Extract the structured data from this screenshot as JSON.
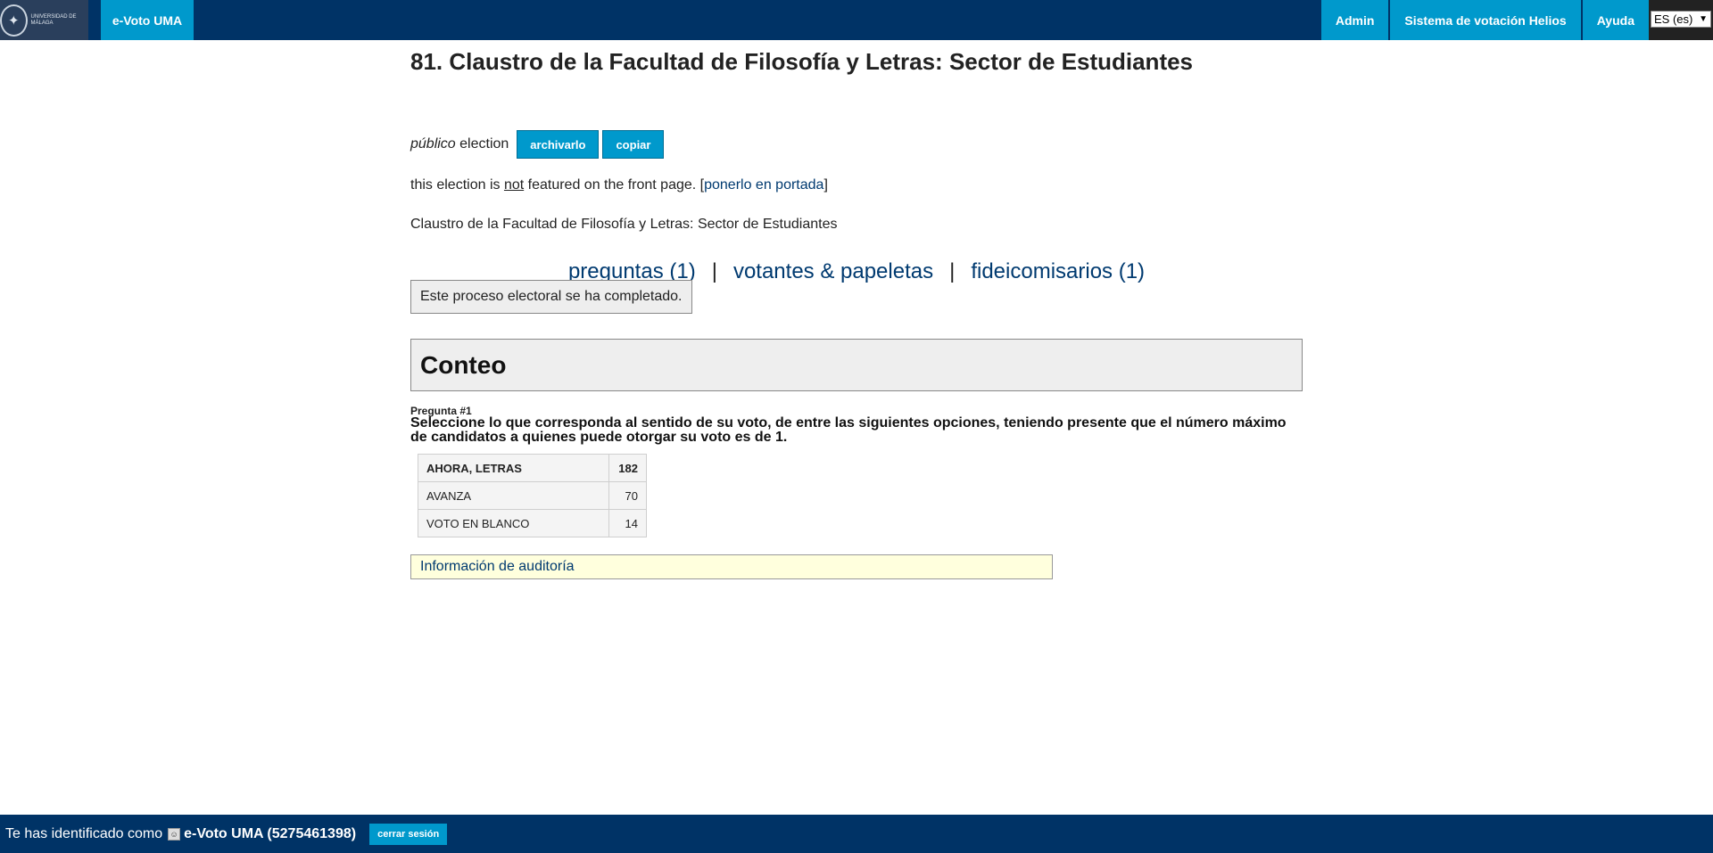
{
  "header": {
    "logo_text": "UNIVERSIDAD DE MÁLAGA",
    "brand": "e-Voto UMA",
    "nav": [
      "Admin",
      "Sistema de votación Helios",
      "Ayuda"
    ],
    "language": "ES (es)"
  },
  "election": {
    "title": "81. Claustro de la Facultad de Filosofía y Letras: Sector de Estudiantes",
    "type_italic": "público",
    "type_suffix": " election",
    "archive_label": "archivarlo",
    "copy_label": "copiar",
    "featured_prefix": "this election is ",
    "featured_not": "not",
    "featured_suffix": " featured on the front page. [",
    "featured_link": "ponerlo en portada",
    "featured_close": "]",
    "description": "Claustro de la Facultad de Filosofía y Letras: Sector de Estudiantes"
  },
  "tabs": {
    "questions": "preguntas (1)",
    "sep": "|",
    "voters": "votantes & papeletas",
    "trustees": "fideicomisarios (1)"
  },
  "status": {
    "completed": "Este proceso electoral se ha completado."
  },
  "results": {
    "heading": "Conteo",
    "question_number": "Pregunta #1",
    "question_text": "Seleccione lo que corresponda al sentido de su voto, de entre las siguientes opciones, teniendo presente que el número máximo de candidatos a quienes puede otorgar su voto es de 1.",
    "rows": [
      {
        "name": "AHORA, LETRAS",
        "votes": "182"
      },
      {
        "name": "AVANZA",
        "votes": "70"
      },
      {
        "name": "VOTO EN BLANCO",
        "votes": "14"
      }
    ],
    "audit_link": "Información de auditoría"
  },
  "footer": {
    "prefix": "Te has identificado como",
    "user": "e-Voto UMA (5275461398)",
    "logout": "cerrar sesión"
  }
}
